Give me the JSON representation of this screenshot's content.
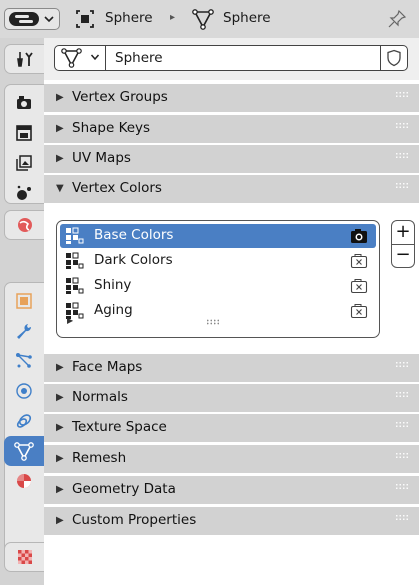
{
  "header": {
    "editor_type_icon": "properties-editor-icon",
    "breadcrumb": {
      "object_icon": "object-square-icon",
      "object_name": "Sphere",
      "separator": "▸",
      "data_icon": "mesh-data-icon",
      "data_name": "Sphere"
    },
    "pin_icon": "pin-icon"
  },
  "tabs": [
    {
      "name": "tool",
      "icon": "tool-icon"
    },
    {
      "name": "render",
      "icon": "render-icon"
    },
    {
      "name": "output",
      "icon": "output-icon"
    },
    {
      "name": "view-layer",
      "icon": "view-layer-icon"
    },
    {
      "name": "scene",
      "icon": "scene-icon"
    },
    {
      "name": "world",
      "icon": "world-icon"
    },
    {
      "name": "object",
      "icon": "object-icon"
    },
    {
      "name": "modifiers",
      "icon": "wrench-icon"
    },
    {
      "name": "particles",
      "icon": "particles-icon"
    },
    {
      "name": "physics",
      "icon": "physics-icon"
    },
    {
      "name": "constraints",
      "icon": "constraints-icon"
    },
    {
      "name": "data",
      "icon": "mesh-data-icon",
      "active": true
    },
    {
      "name": "material",
      "icon": "material-icon"
    },
    {
      "name": "texture",
      "icon": "texture-icon"
    }
  ],
  "mesh_selector": {
    "value": "Sphere"
  },
  "panels": {
    "vertex_groups": "Vertex Groups",
    "shape_keys": "Shape Keys",
    "uv_maps": "UV Maps",
    "vertex_colors": "Vertex Colors",
    "face_maps": "Face Maps",
    "normals": "Normals",
    "texture_space": "Texture Space",
    "remesh": "Remesh",
    "geometry_data": "Geometry Data",
    "custom_properties": "Custom Properties"
  },
  "vertex_colors": {
    "items": [
      {
        "name": "Base Colors",
        "selected": true,
        "render_icon": "camera-icon"
      },
      {
        "name": "Dark Colors",
        "selected": false,
        "render_icon": "camera-disabled-icon"
      },
      {
        "name": "Shiny",
        "selected": false,
        "render_icon": "camera-disabled-icon"
      },
      {
        "name": "Aging",
        "selected": false,
        "render_icon": "camera-disabled-icon"
      }
    ],
    "add_label": "+",
    "remove_label": "−"
  },
  "colors": {
    "accent": "#4a7fc4",
    "panel_header": "#d2d2d2",
    "header_bar": "#d9d9d9",
    "tab_column": "#d3d3d3"
  }
}
